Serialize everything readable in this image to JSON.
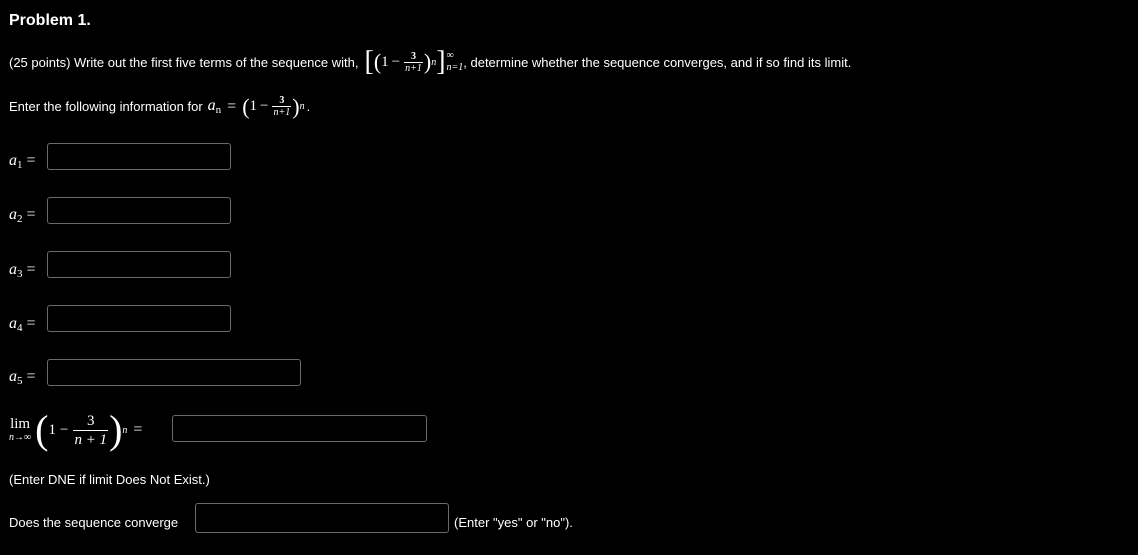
{
  "problem": {
    "title": "Problem 1.",
    "intro_before": "(25 points) Write out the first five terms of the sequence with,",
    "intro_after": ", determine whether the sequence converges, and if so find its limit.",
    "formula": {
      "one": "1",
      "minus": "−",
      "num": "3",
      "den": "n+1",
      "exp": "n",
      "upper": "∞",
      "lower": "n=1"
    },
    "enter_info": "Enter the following information for",
    "an_var": "a",
    "an_sub": "n",
    "an_eq": "=",
    "an_period": "."
  },
  "terms": [
    {
      "var": "a",
      "sub": "1",
      "eq": "=",
      "value": ""
    },
    {
      "var": "a",
      "sub": "2",
      "eq": "=",
      "value": ""
    },
    {
      "var": "a",
      "sub": "3",
      "eq": "=",
      "value": ""
    },
    {
      "var": "a",
      "sub": "4",
      "eq": "=",
      "value": ""
    },
    {
      "var": "a",
      "sub": "5",
      "eq": "=",
      "value": ""
    }
  ],
  "limit": {
    "lim": "lim",
    "under": "n→∞",
    "one": "1",
    "minus": "−",
    "num": "3",
    "den": "n + 1",
    "exp": "n",
    "eq": "=",
    "value": "",
    "hint": "(Enter DNE if limit Does Not Exist.)"
  },
  "converge": {
    "label": "Does the sequence converge",
    "value": "",
    "hint": "(Enter \"yes\" or \"no\")."
  }
}
